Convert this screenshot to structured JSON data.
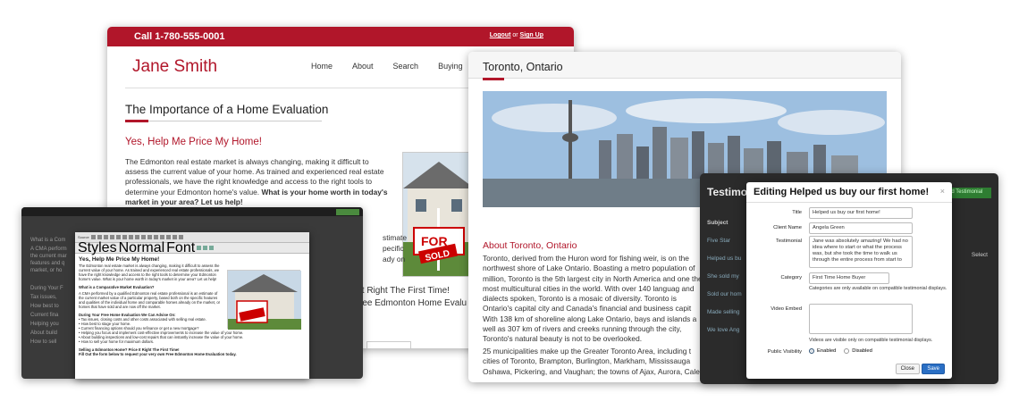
{
  "jane_window": {
    "phone": "Call 1-780-555-0001",
    "logout": "Logout",
    "or": "or",
    "signup": "Sign Up",
    "brand": "Jane Smith",
    "nav": [
      "Home",
      "About",
      "Search",
      "Buying"
    ],
    "heading": "The Importance of a Home Evaluation",
    "subheading": "Yes, Help Me Price My Home!",
    "paragraph": "The Edmonton real estate market is always changing, making it difficult to assess the current value of your home. As trained and experienced real estate professionals, we have the right knowledge and access to the right tools to determine your Edmonton home's value.",
    "paragraph_bold": "What is your home worth in today's market in your area? Let us help!",
    "frag1": "stimate",
    "frag2": "pecific",
    "frag3": "ady on",
    "cta1": "It Right The First Time!",
    "cta2": "ree Edmonton Home Evalu"
  },
  "toronto_window": {
    "title": "Toronto, Ontario",
    "about_heading": "About Toronto, Ontario",
    "p1": "Toronto, derived from the Huron word for fishing weir, is on the northwest shore of Lake Ontario. Boasting a metro population of million, Toronto is the 5th largest city in North America and one the most multicultural cities in the world. With over 140 languag and dialects spoken, Toronto is a mosaic of diversity. Toronto is Ontario's capital city and Canada's financial and business capit With 138 km of shoreline along Lake Ontario, bays and islands a well as 307 km of rivers and creeks running through the city, Toronto's natural beauty is not to be overlooked.",
    "p2": "25 municipalities make up the Greater Toronto Area, including t cities of Toronto, Brampton, Burlington, Markham, Mississauga Oshawa, Pickering, and Vaughan; the towns of Ajax, Aurora, Cale"
  },
  "testimonials_window": {
    "bg_title": "Testimo",
    "add_button": "Add Testimonial",
    "subject_header": "Subject",
    "select_header": "Select",
    "rows": [
      "Five Star",
      "Helped us bu",
      "She sold my",
      "Sold our hom",
      "Made selling",
      "We love Ang"
    ]
  },
  "modal": {
    "title": "Editing Helped us buy our first home!",
    "close_icon": "×",
    "fields": {
      "title_label": "Title",
      "title_value": "Helped us buy our first home!",
      "client_label": "Client Name",
      "client_value": "Angela Green",
      "testimonial_label": "Testimonial",
      "testimonial_value": "Jane was absolutely amazing! We had no idea where to start or what the process was, but she took the time to walk us through the entire process from start to",
      "category_label": "Category",
      "category_value": "First Time Home Buyer",
      "category_help": "Categories are only available on compatible testimonial displays.",
      "video_label": "Video Embed",
      "video_help": "Videos are visible only on compatible testimonial displays.",
      "visibility_label": "Public Visibility",
      "enabled": "Enabled",
      "disabled": "Disabled"
    },
    "close_button": "Close",
    "save_button": "Save"
  },
  "editor": {
    "heading": "Yes, Help Me Price My Home!",
    "p1": "The Edmonton real estate market is always changing, making it difficult to assess the current value of your home. As trained and experienced real estate professionals, we have the right knowledge and access to the right tools to determine your Edmonton home's value. What is your home worth in today's market in your area? Let us help!",
    "h2": "What is a Comparative Market Evaluation?",
    "p2": "A CMA performed by a qualified Edmonton real estate professional is an estimate of the current market value of a particular property, based both on the specific features and qualities of the individual home and comparable homes already on the market, or homes that have sold and are now off the market.",
    "h3": "During Your Free Home Evaluation We Can Advise On:",
    "list": [
      "Tax issues, closing costs and other costs associated with selling real estate.",
      "How best to stage your home.",
      "Current financing options should you refinance or get a new mortgage?",
      "Helping you focus and implement cost-effective improvements to increase the value of your home.",
      "About building inspections and low-cost repairs that can instantly increase the value of your home.",
      "How to sell your home for maximum dollars."
    ],
    "h4": "Selling a Edmonton Home? Price It Right The First Time!",
    "h5": "Fill Out the form below to request your very own Free Edmonton Home Evaluation today.",
    "source_label": "Source",
    "styles_label": "Styles",
    "normal_label": "Normal",
    "font_label": "Font",
    "bg_lines": [
      "What is a Com",
      "A CMA perform",
      "the current mar",
      "features and q",
      "market, or ho",
      "During Your F",
      "Tax issues,",
      "How best to",
      "Current fina",
      "Helping you",
      "About build",
      "How to sell"
    ]
  }
}
